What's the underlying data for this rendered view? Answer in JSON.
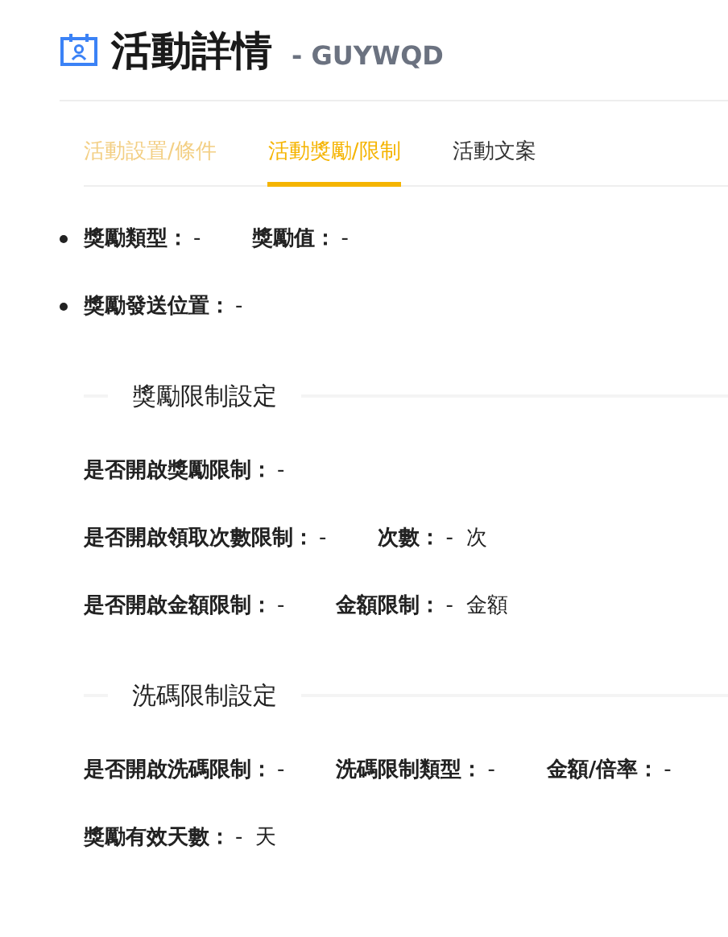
{
  "header": {
    "title": "活動詳情",
    "code": "- GUYWQD"
  },
  "tabs": [
    {
      "label": "活動設置/條件",
      "selected": false,
      "hovered": true
    },
    {
      "label": "活動獎勵/限制",
      "selected": true,
      "hovered": false
    },
    {
      "label": "活動文案",
      "selected": false,
      "hovered": false
    }
  ],
  "bullets": [
    [
      {
        "label": "獎勵類型：",
        "value": "-"
      },
      {
        "label": "獎勵值：",
        "value": "-"
      }
    ],
    [
      {
        "label": "獎勵發送位置：",
        "value": "-"
      }
    ]
  ],
  "sections": [
    {
      "title": "獎勵限制設定",
      "rows": [
        [
          {
            "label": "是否開啟獎勵限制：",
            "value": "-"
          }
        ],
        [
          {
            "label": "是否開啟領取次數限制：",
            "value": "-"
          },
          {
            "label": "次數：",
            "value": "-",
            "unit": "次"
          }
        ],
        [
          {
            "label": "是否開啟金額限制：",
            "value": "-"
          },
          {
            "label": "金額限制：",
            "value": "-",
            "unit": "金額"
          }
        ]
      ]
    },
    {
      "title": "洗碼限制設定",
      "rows": [
        [
          {
            "label": "是否開啟洗碼限制：",
            "value": "-"
          },
          {
            "label": "洗碼限制類型：",
            "value": "-"
          },
          {
            "label": "金額/倍率：",
            "value": "-"
          }
        ],
        [
          {
            "label": "獎勵有效天數：",
            "value": "-",
            "unit": "天"
          }
        ]
      ]
    }
  ]
}
